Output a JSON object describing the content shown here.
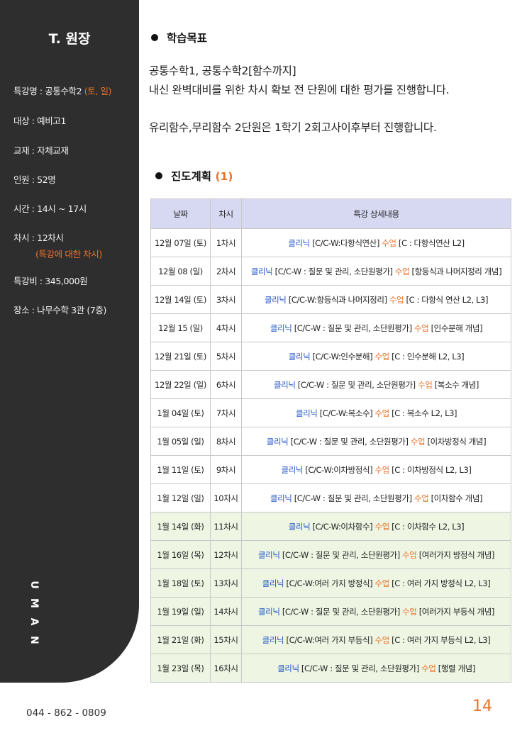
{
  "sidebar": {
    "title": "T. 원장",
    "course_label": "특강명 : 공통수학2 ",
    "course_days": "(토, 일)",
    "target": "대상 : 예비고1",
    "textbook": "교재 : 자체교재",
    "capacity": "인원 : 52명",
    "time": "시간 : 14시 ~ 17시",
    "sessions": "차시 : 12차시",
    "sessions_note": "(특강에 대한 차시)",
    "fee": "특강비 : 345,000원",
    "location": "장소 : 나무수학 3관 (7층)",
    "logo_letters": [
      "N",
      "A",
      "M",
      "U"
    ]
  },
  "footer": {
    "phone": "044 - 862 - 0809",
    "page_number": "14"
  },
  "goals": {
    "heading": "학습목표",
    "line1": "공통수학1, 공통수학2[함수까지]",
    "line2": "내신 완벽대비를 위한 차시 확보 전 단원에 대한 평가를 진행합니다.",
    "line3": "유리함수,무리함수 2단원은 1학기 2회고사이후부터 진행합니다."
  },
  "plan": {
    "heading": "진도계획",
    "heading_count": "(1)",
    "columns": [
      "날짜",
      "차시",
      "특강 상세내용"
    ],
    "rows": [
      {
        "date": "12월 07일 (토)",
        "session": "1차시",
        "clinic": "클리닉",
        "c": "[C/C-W:다항식연산]",
        "lesson": "수업",
        "l": "[C : 다항식연산 L2]"
      },
      {
        "date": "12월 08 (일)",
        "session": "2차시",
        "clinic": "클리닉",
        "c": "[C/C-W : 질문 및 관리, 소단원평가]",
        "lesson": "수업",
        "l": "[항등식과 나머지정리 개념]"
      },
      {
        "date": "12월 14일 (토)",
        "session": "3차시",
        "clinic": "클리닉",
        "c": "[C/C-W:항등식과 나머지정리]",
        "lesson": "수업",
        "l": "[C : 다항식 연산 L2, L3]"
      },
      {
        "date": "12월 15 (일)",
        "session": "4차시",
        "clinic": "클리닉",
        "c": "[C/C-W : 질문 및 관리, 소단원평가]",
        "lesson": "수업",
        "l": "[인수분해 개념]"
      },
      {
        "date": "12월 21일 (토)",
        "session": "5차시",
        "clinic": "클리닉",
        "c": "[C/C-W:인수분해]",
        "lesson": "수업",
        "l": "[C : 인수분해 L2, L3]"
      },
      {
        "date": "12월 22일 (일)",
        "session": "6차시",
        "clinic": "클리닉",
        "c": "[C/C-W : 질문 및 관리, 소단원평가]",
        "lesson": "수업",
        "l": "[복소수 개념]"
      },
      {
        "date": "1월 04일 (토)",
        "session": "7차시",
        "clinic": "클리닉",
        "c": "[C/C-W:복소수]",
        "lesson": "수업",
        "l": "[C : 복소수 L2, L3]"
      },
      {
        "date": "1월 05일 (일)",
        "session": "8차시",
        "clinic": "클리닉",
        "c": "[C/C-W : 질문 및 관리, 소단원평가]",
        "lesson": "수업",
        "l": "[이차방정식 개념]"
      },
      {
        "date": "1월 11일 (토)",
        "session": "9차시",
        "clinic": "클리닉",
        "c": "[C/C-W:이차방정식]",
        "lesson": "수업",
        "l": "[C : 이차방정식 L2, L3]"
      },
      {
        "date": "1월 12일 (일)",
        "session": "10차시",
        "clinic": "클리닉",
        "c": "[C/C-W : 질문 및 관리, 소단원평가]",
        "lesson": "수업",
        "l": "[이차함수 개념]"
      },
      {
        "date": "1월 14일 (화)",
        "session": "11차시",
        "clinic": "클리닉",
        "c": "[C/C-W:이차함수]",
        "lesson": "수업",
        "l": "[C : 이차함수 L2, L3]"
      },
      {
        "date": "1월 16일 (목)",
        "session": "12차시",
        "clinic": "클리닉",
        "c": "[C/C-W : 질문 및 관리, 소단원평가]",
        "lesson": "수업",
        "l": "[여러가지 방정식 개념]"
      },
      {
        "date": "1월 18일 (토)",
        "session": "13차시",
        "clinic": "클리닉",
        "c": "[C/C-W:여러 가지 방정식]",
        "lesson": "수업",
        "l": "[C : 여러 가지 방정식 L2, L3]"
      },
      {
        "date": "1월 19일 (일)",
        "session": "14차시",
        "clinic": "클리닉",
        "c": "[C/C-W : 질문 및 관리, 소단원평가]",
        "lesson": "수업",
        "l": "[여러가지 부등식 개념]"
      },
      {
        "date": "1월 21일 (화)",
        "session": "15차시",
        "clinic": "클리닉",
        "c": "[C/C-W:여러 가지 부등식]",
        "lesson": "수업",
        "l": "[C : 여러 가지 부등식 L2, L3]"
      },
      {
        "date": "1월 23일 (목)",
        "session": "16차시",
        "clinic": "클리닉",
        "c": "[C/C-W : 질문 및 관리, 소단원평가]",
        "lesson": "수업",
        "l": "[행렬 개념]"
      }
    ],
    "highlight_color": "#eef6e3",
    "header_color": "#d7d9f2",
    "clinic_color": "#2356c9",
    "lesson_color": "#e8732b"
  }
}
